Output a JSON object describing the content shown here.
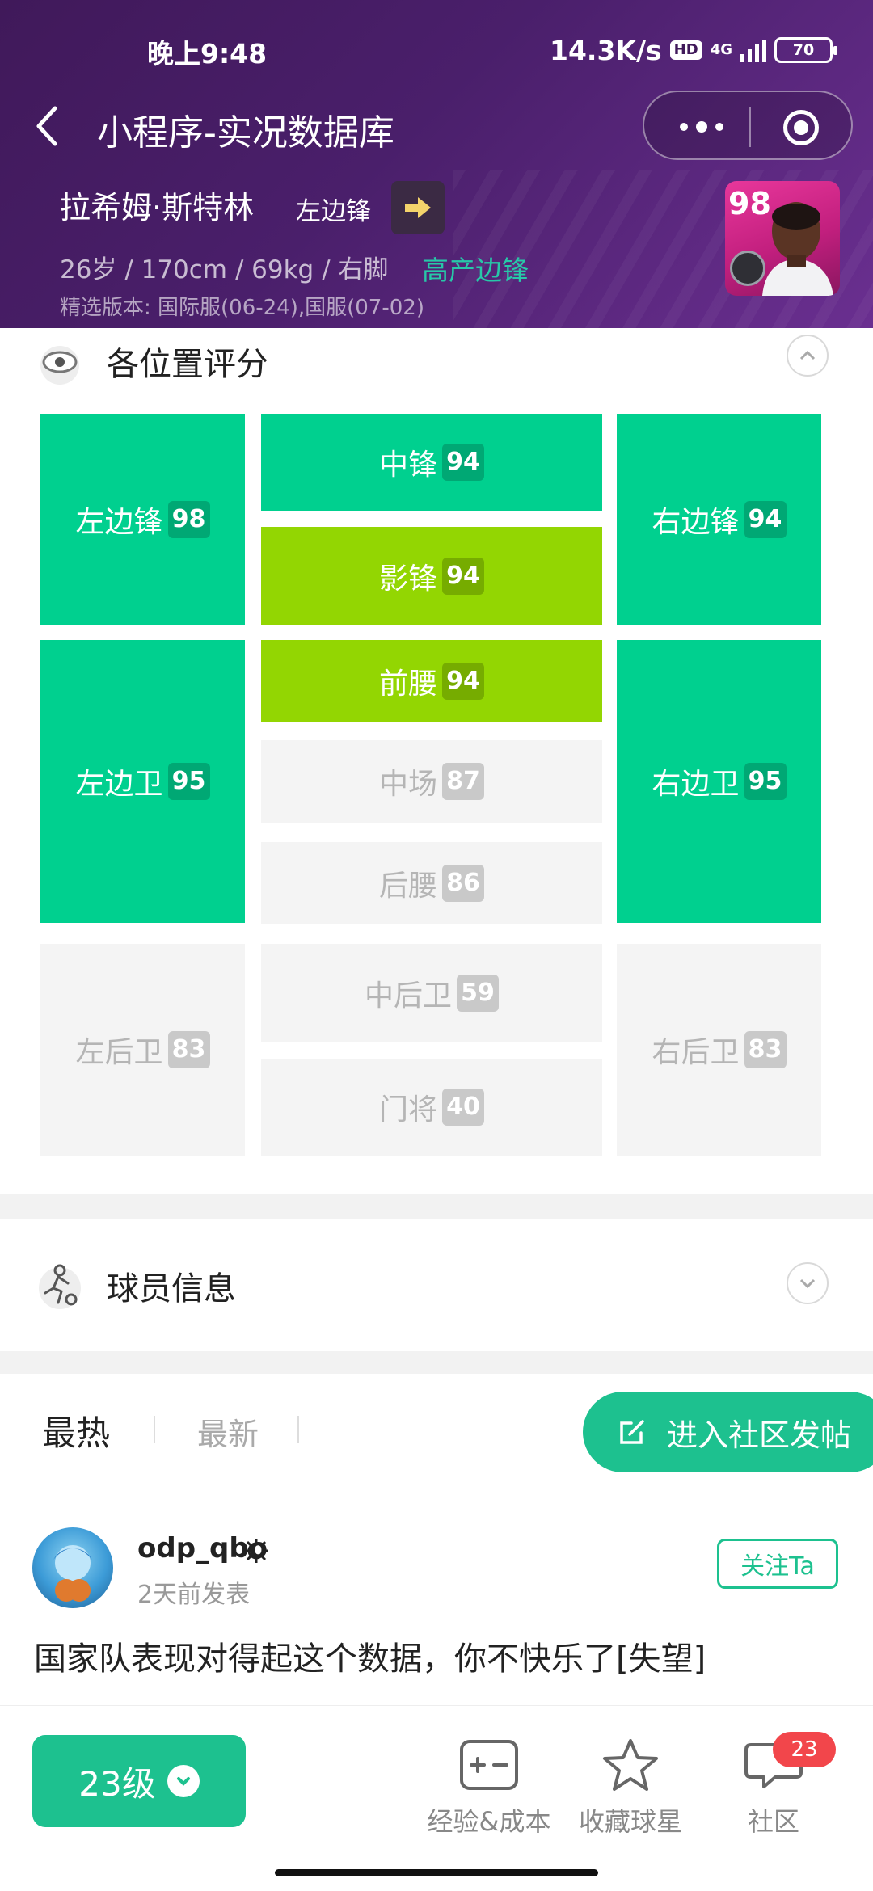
{
  "status_bar": {
    "time": "晚上9:48",
    "net_speed": "14.3K/s",
    "hd": "HD",
    "network": "4G",
    "battery": "70"
  },
  "nav": {
    "title": "小程序-实况数据库",
    "back_icon": "chevron-left-icon",
    "more_icon": "more-dots-icon",
    "close_icon": "target-close-icon"
  },
  "player": {
    "name": "拉希姆·斯特林",
    "position": "左边锋",
    "stats": "26岁 / 170cm / 69kg / 右脚",
    "tag": "高产边锋",
    "version": "精选版本: 国际服(06-24),国服(07-02)",
    "card_rating": "98"
  },
  "position_section": {
    "title": "各位置评分",
    "tiles": {
      "lwf": {
        "label": "左边锋",
        "value": "98"
      },
      "cf": {
        "label": "中锋",
        "value": "94"
      },
      "rwf": {
        "label": "右边锋",
        "value": "94"
      },
      "ss": {
        "label": "影锋",
        "value": "94"
      },
      "amf": {
        "label": "前腰",
        "value": "94"
      },
      "lmf": {
        "label": "左边卫",
        "value": "95"
      },
      "rmf": {
        "label": "右边卫",
        "value": "95"
      },
      "cmf": {
        "label": "中场",
        "value": "87"
      },
      "dmf": {
        "label": "后腰",
        "value": "86"
      },
      "lb": {
        "label": "左后卫",
        "value": "83"
      },
      "cb": {
        "label": "中后卫",
        "value": "59"
      },
      "rb": {
        "label": "右后卫",
        "value": "83"
      },
      "gk": {
        "label": "门将",
        "value": "40"
      }
    }
  },
  "info_section": {
    "title": "球员信息"
  },
  "community": {
    "tab_hot": "最热",
    "tab_new": "最新",
    "post_button": "进入社区发帖",
    "post": {
      "username": "odp_qbo",
      "time": "2天前发表",
      "follow": "关注Ta",
      "text": "国家队表现对得起这个数据，你不快乐了[失望]"
    }
  },
  "bottom_bar": {
    "level": "23级",
    "exp_cost": "经验&成本",
    "favorite": "收藏球星",
    "community": "社区",
    "community_badge": "23"
  },
  "colors": {
    "header_purple": "#40195a",
    "accent_green": "#1dc18f",
    "tile_green": "#00d08f",
    "tile_lime": "#93d602",
    "tag_teal": "#27c8a8",
    "badge_red": "#f2464b"
  }
}
